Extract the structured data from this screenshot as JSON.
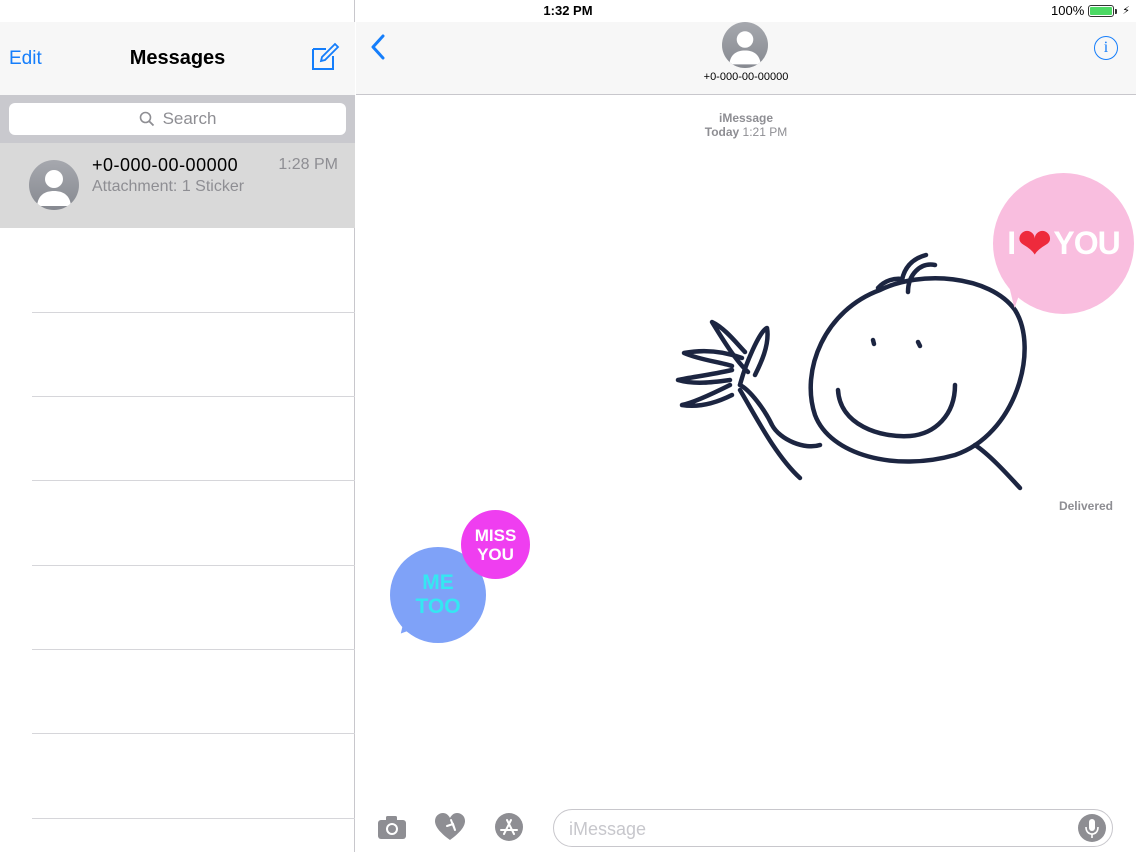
{
  "status_bar": {
    "device": "iPad",
    "time": "1:32 PM",
    "battery": "100%",
    "battery_level": 1.0
  },
  "left_pane": {
    "edit_label": "Edit",
    "title": "Messages",
    "search_placeholder": "Search",
    "conversations": [
      {
        "name": "+0-000-00-00000",
        "time": "1:28 PM",
        "preview": "Attachment: 1 Sticker"
      }
    ]
  },
  "right_pane": {
    "contact_number": "+0-000-00-00000",
    "header_service": "iMessage",
    "header_day": "Today",
    "header_time": "1:21 PM",
    "delivered_label": "Delivered",
    "stickers": {
      "love": {
        "left": "I",
        "right": "YOU",
        "heart": "❤"
      },
      "miss": "MISS YOU",
      "metoo": "ME TOO"
    },
    "input_placeholder": "iMessage"
  },
  "colors": {
    "accent": "#157efb",
    "selected_row": "#d9d9d9",
    "nav_bg": "#f7f7f7"
  }
}
